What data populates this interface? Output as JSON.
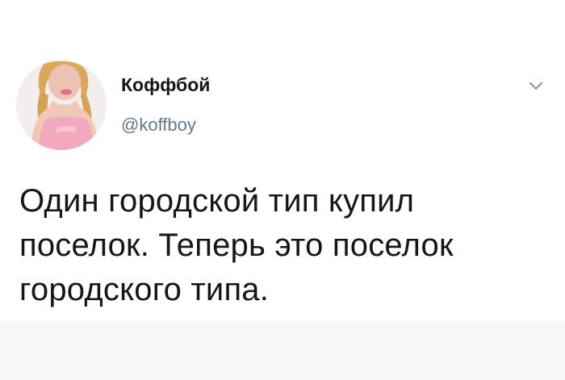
{
  "tweet": {
    "author": {
      "display_name": "Коффбой",
      "handle": "@koffboy",
      "avatar_icon": "profile-avatar"
    },
    "menu_icon": "chevron-down-icon",
    "text_lines": [
      "Один городской тип купил",
      "поселок. Теперь это поселок",
      "городского типа."
    ]
  },
  "colors": {
    "text_primary": "#14171a",
    "text_secondary": "#657786",
    "background": "#ffffff",
    "bottom_band": "#f7f7f8"
  }
}
